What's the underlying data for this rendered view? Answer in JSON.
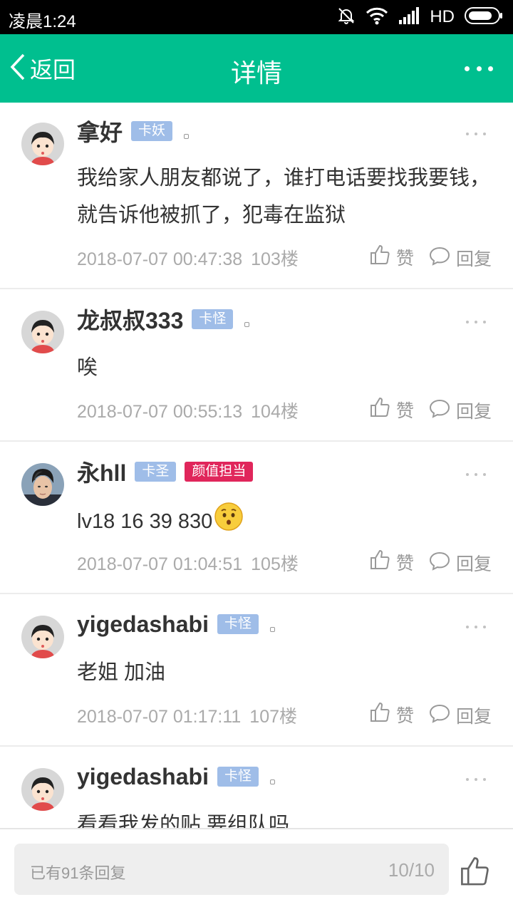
{
  "status": {
    "time": "凌晨1:24",
    "network": "HD"
  },
  "nav": {
    "back_label": "返回",
    "title": "详情"
  },
  "actions": {
    "like_label": "赞",
    "reply_label": "回复"
  },
  "comments": [
    {
      "username": "拿好",
      "badges": [
        {
          "text": "卡妖",
          "color": "#9fbde8"
        }
      ],
      "content": "我给家人朋友都说了，谁打电话要找我要钱，就告诉他被抓了，犯毒在监狱",
      "timestamp": "2018-07-07 00:47:38",
      "floor": "103楼",
      "avatar": "cartoon-avatar"
    },
    {
      "username": "龙叔叔333",
      "badges": [
        {
          "text": "卡怪",
          "color": "#9fbde8"
        }
      ],
      "content": "唉",
      "timestamp": "2018-07-07 00:55:13",
      "floor": "104楼",
      "avatar": "cartoon-avatar"
    },
    {
      "username": "永hll",
      "badges": [
        {
          "text": "卡圣",
          "color": "#9fbde8"
        },
        {
          "text": "颜值担当",
          "color": "#e0265b"
        }
      ],
      "content": "lv18 16 39 830",
      "emoji": "worried-face-emoji",
      "timestamp": "2018-07-07 01:04:51",
      "floor": "105楼",
      "avatar": "photo-avatar"
    },
    {
      "username": "yigedashabi",
      "badges": [
        {
          "text": "卡怪",
          "color": "#9fbde8"
        }
      ],
      "content": "老姐 加油",
      "timestamp": "2018-07-07 01:17:11",
      "floor": "107楼",
      "avatar": "cartoon-avatar"
    },
    {
      "username": "yigedashabi",
      "badges": [
        {
          "text": "卡怪",
          "color": "#9fbde8"
        }
      ],
      "content": "看看我发的贴 要组队吗",
      "timestamp": "",
      "floor": "",
      "avatar": "cartoon-avatar"
    }
  ],
  "reply_bar": {
    "placeholder": "已有91条回复",
    "counter": "10/10"
  },
  "colors": {
    "accent": "#00bf8f",
    "badge_blue": "#9fbde8",
    "badge_pink": "#e0265b"
  },
  "icons": [
    "muted-bell-icon",
    "wifi-icon",
    "signal-icon",
    "battery-icon",
    "back-chevron-icon",
    "more-icon",
    "thumbs-up-icon",
    "comment-bubble-icon"
  ]
}
